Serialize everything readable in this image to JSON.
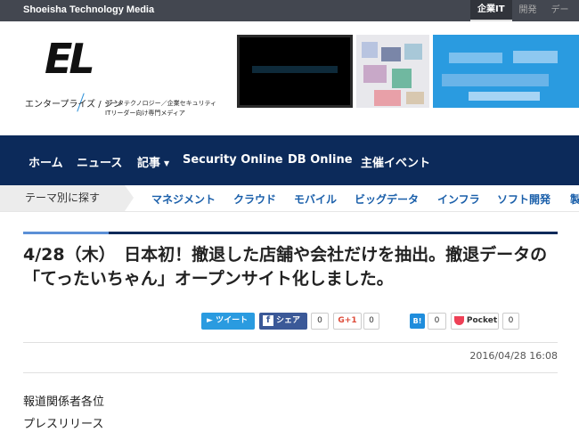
{
  "topbar": {
    "brand": "Shoeisha Technology Media",
    "nav": [
      "企業IT",
      "開発",
      "デー"
    ]
  },
  "header": {
    "logo_mark": "EL",
    "logo_sub": "エンタープライズ / ジン",
    "tagline_line1": "データテクノロジー／企業セキュリティ",
    "tagline_line2": "ITリーダー向け専門メディア"
  },
  "main_nav": {
    "items": [
      "ホーム",
      "ニュース",
      "記事",
      "Security Online",
      "DB Online",
      "主催イベント"
    ],
    "dropdown_caret": "▼"
  },
  "sub_nav": {
    "label": "テーマ別に探す",
    "items": [
      "マネジメント",
      "クラウド",
      "モバイル",
      "ビッグデータ",
      "インフラ",
      "ソフト開発",
      "製"
    ]
  },
  "article": {
    "title": "4/28（木）　日本初！撤退した店舗や会社だけを抽出。撤退データの「てったいちゃん」オープンサイト化しました。",
    "date": "2016/04/28 16:08",
    "body_line1": "報道関係者各位",
    "body_line2": "プレスリリース"
  },
  "share": {
    "tweet_label": "ツイート",
    "facebook_label": "シェア",
    "facebook_count": "0",
    "gplus_label": "G+1",
    "gplus_count": "0",
    "hatena_label": "B!",
    "hatena_count": "0",
    "pocket_label": "Pocket",
    "pocket_count": "0"
  },
  "colors": {
    "topbar": "#434750",
    "nav": "#0c2a5a",
    "link": "#1a5faa",
    "twitter": "#2a9be0",
    "facebook": "#3b5998",
    "pocket": "#ee4056"
  }
}
